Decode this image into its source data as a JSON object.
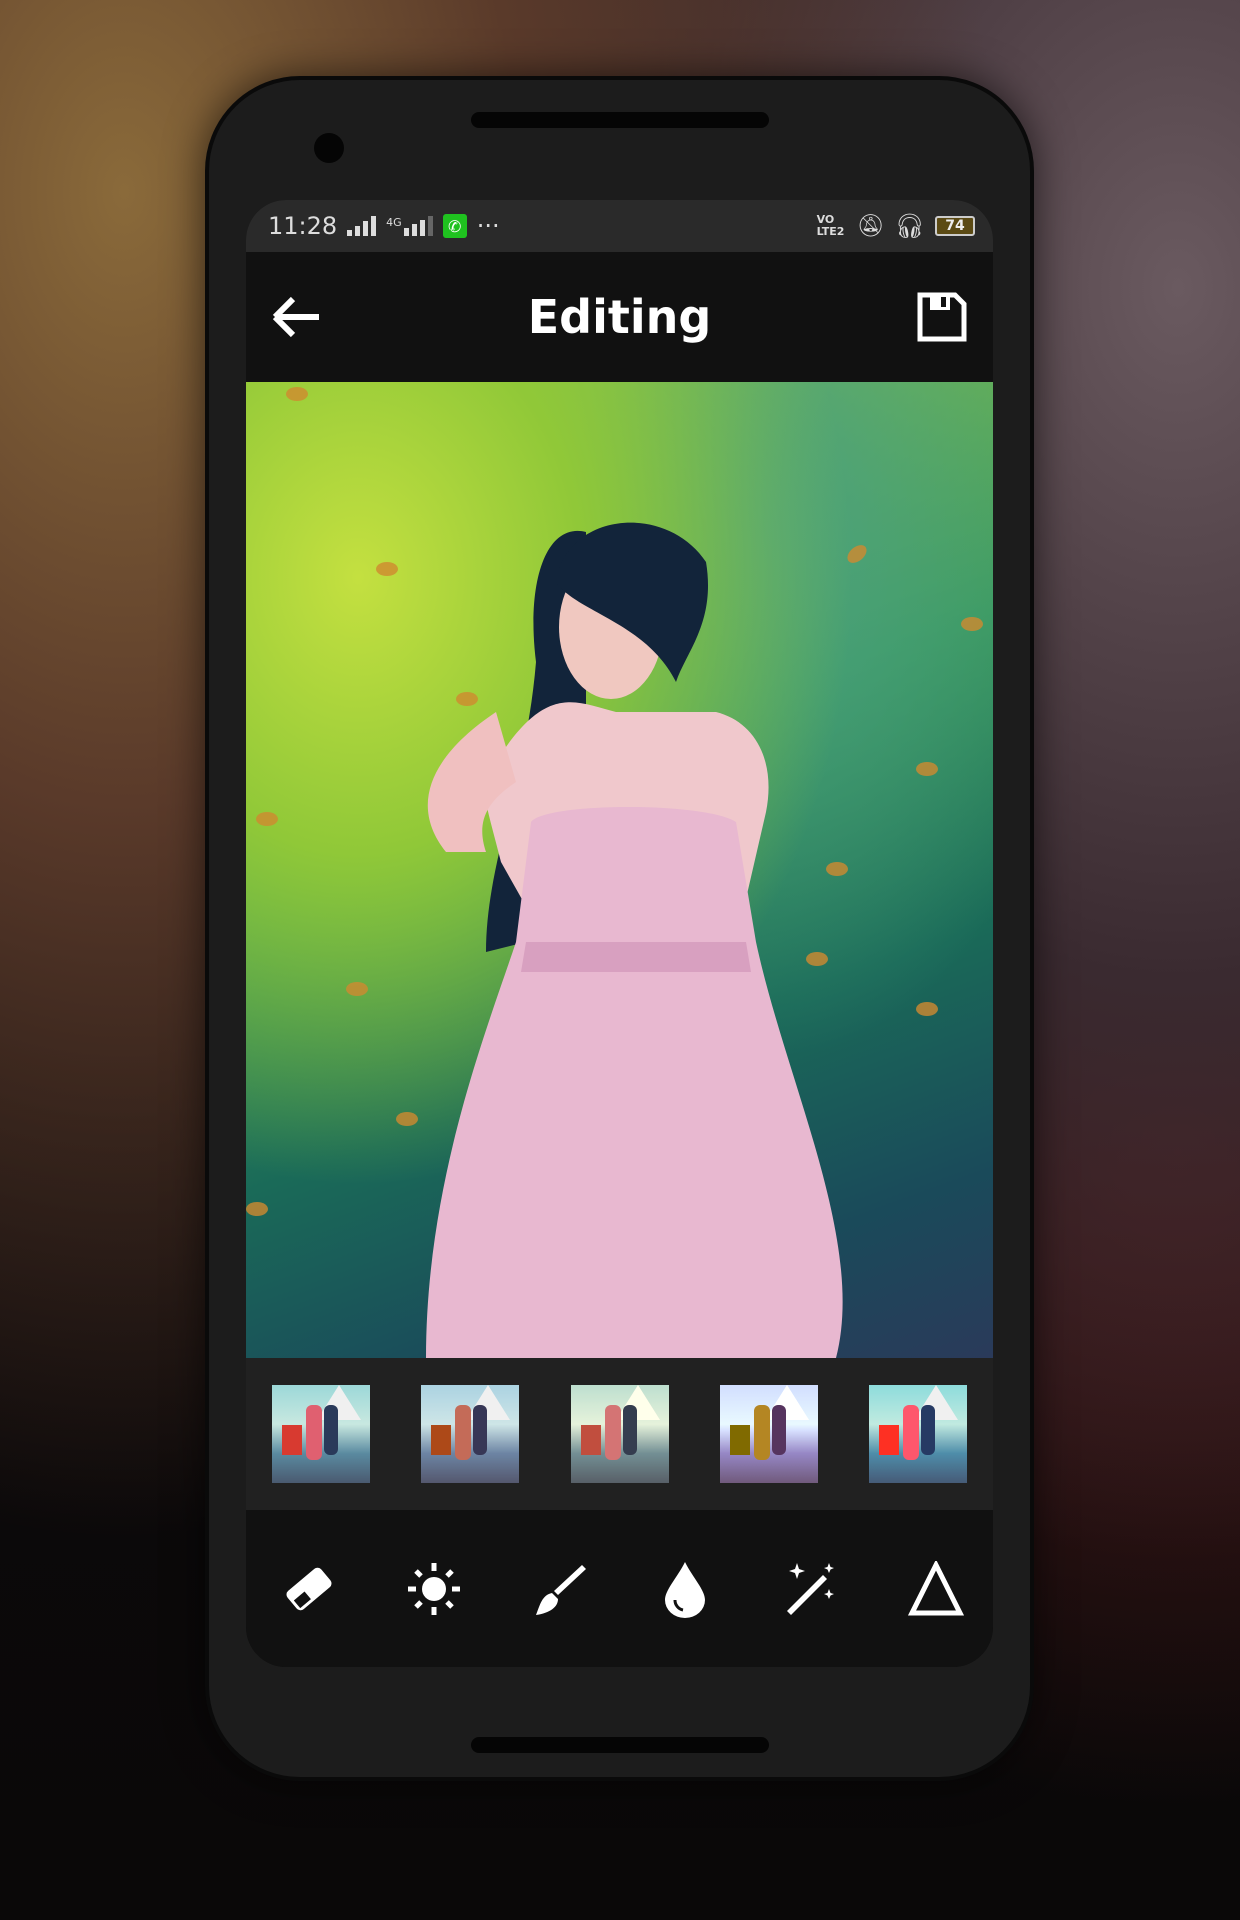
{
  "status_bar": {
    "time": "11:28",
    "network": "4G",
    "volte": "VO LTE2",
    "battery": "74",
    "icons": [
      "signal-icon",
      "signal-4g-icon",
      "whatsapp-icon",
      "more-icon",
      "volte-icon",
      "mute-vibrate-icon",
      "headphones-icon",
      "battery-icon"
    ],
    "more": "···"
  },
  "toolbar": {
    "title": "Editing",
    "back_icon": "arrow-left-icon",
    "save_icon": "floppy-disk-icon"
  },
  "filters": {
    "count": 5,
    "items": [
      {
        "name": "filter-1"
      },
      {
        "name": "filter-2"
      },
      {
        "name": "filter-3"
      },
      {
        "name": "filter-4"
      },
      {
        "name": "filter-5"
      }
    ]
  },
  "tools": [
    {
      "icon": "eraser-icon"
    },
    {
      "icon": "brightness-icon"
    },
    {
      "icon": "brush-icon"
    },
    {
      "icon": "drop-icon"
    },
    {
      "icon": "magic-wand-icon"
    },
    {
      "icon": "triangle-icon"
    }
  ],
  "colors": {
    "background": "#111111",
    "status_bar": "#2a2a2a",
    "thumb_strip": "#212121",
    "whatsapp": "#1fc21f"
  }
}
